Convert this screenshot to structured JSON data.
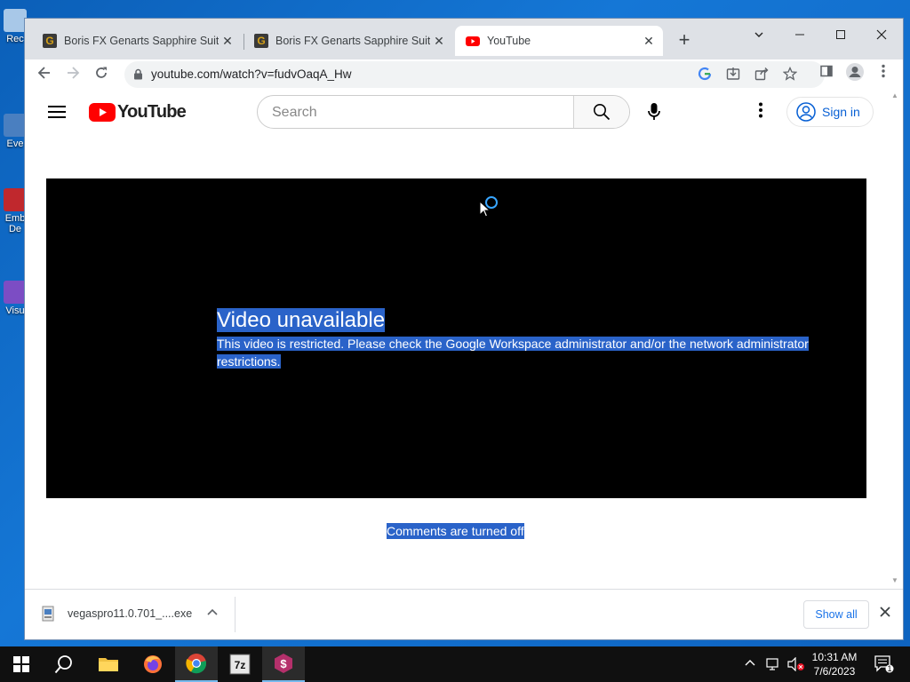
{
  "desktop": {
    "icons": [
      {
        "label": "Rec",
        "color": "#a8c8e8"
      },
      {
        "label": "Eve",
        "color": "#4a7fc0"
      },
      {
        "label": "Emb\nDe",
        "color": "#c0282d"
      },
      {
        "label": "Visu",
        "color": "#7c4dc4"
      }
    ]
  },
  "browser": {
    "tabs": [
      {
        "title": "Boris FX Genarts Sapphire Suite",
        "active": false
      },
      {
        "title": "Boris FX Genarts Sapphire Suite ...",
        "active": false
      },
      {
        "title": "YouTube",
        "active": true
      }
    ],
    "url": "youtube.com/watch?v=fudvOaqA_Hw"
  },
  "youtube": {
    "logo_text": "YouTube",
    "search_placeholder": "Search",
    "sign_in_label": "Sign in",
    "error_title": "Video unavailable",
    "error_message": "This video is restricted. Please check the Google Workspace administrator and/or the network administrator restrictions.",
    "comments_status": "Comments are turned off",
    "brand_red": "#ff0000"
  },
  "downloads": {
    "file_name": "vegaspro11.0.701_....exe",
    "show_all_label": "Show all"
  },
  "taskbar": {
    "time": "10:31 AM",
    "date": "7/6/2023",
    "notification_count": "1"
  }
}
